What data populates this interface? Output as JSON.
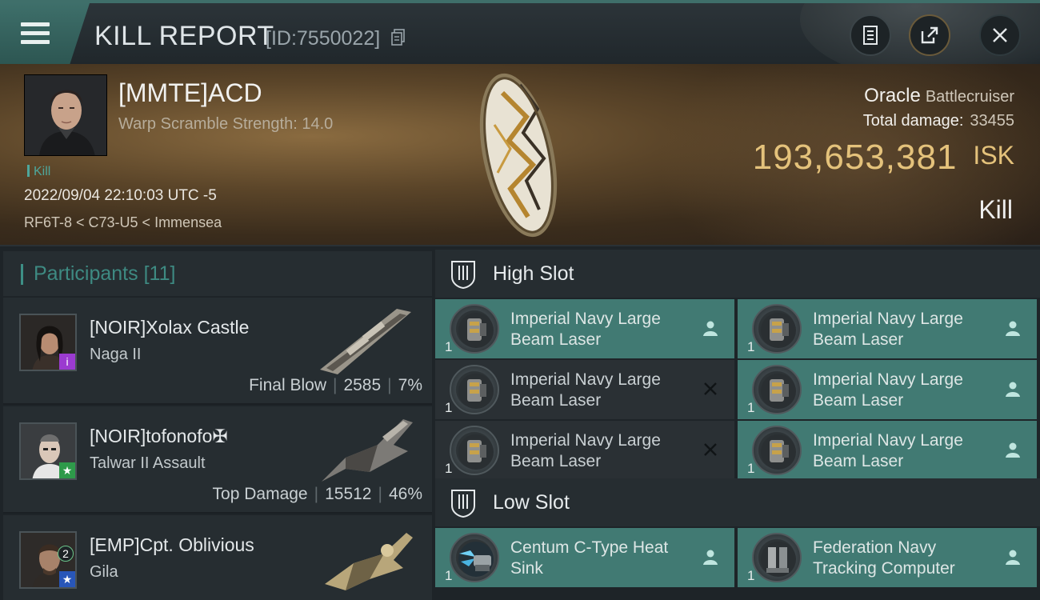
{
  "header": {
    "title": "KILL REPORT",
    "report_id": "[ID:7550022]"
  },
  "victim": {
    "name": "[MMTE]ACD",
    "scram": "Warp Scramble Strength: 14.0",
    "kill_tag": "Kill",
    "timestamp": "2022/09/04 22:10:03 UTC -5",
    "location": "RF6T-8 < C73-U5 < Immensea",
    "ship_name": "Oracle",
    "ship_class": "Battlecruiser",
    "damage_label": "Total damage:",
    "damage_value": "33455",
    "isk_value": "193,653,381",
    "isk_unit": "ISK",
    "result": "Kill"
  },
  "participants": {
    "label": "Participants",
    "count": "[11]",
    "rows": [
      {
        "name": "[NOIR]Xolax Castle",
        "ship": "Naga II",
        "stat_label": "Final Blow",
        "damage": "2585",
        "percent": "7%",
        "badge": "i"
      },
      {
        "name": "[NOIR]tofonofo✠",
        "ship": "Talwar II Assault",
        "stat_label": "Top Damage",
        "damage": "15512",
        "percent": "46%",
        "badge": "★"
      },
      {
        "name": "[EMP]Cpt. Oblivious",
        "ship": "Gila",
        "stat_label": "",
        "damage": "",
        "percent": "",
        "badge": "★",
        "badge_num": "2"
      }
    ]
  },
  "fittings": {
    "high_label": "High Slot",
    "low_label": "Low Slot",
    "high": [
      {
        "name": "Imperial Navy Large Beam Laser",
        "qty": "1",
        "state": "active"
      },
      {
        "name": "Imperial Navy Large Beam Laser",
        "qty": "1",
        "state": "active"
      },
      {
        "name": "Imperial Navy Large Beam Laser",
        "qty": "1",
        "state": "destroyed"
      },
      {
        "name": "Imperial Navy Large Beam Laser",
        "qty": "1",
        "state": "active"
      },
      {
        "name": "Imperial Navy Large Beam Laser",
        "qty": "1",
        "state": "destroyed"
      },
      {
        "name": "Imperial Navy Large Beam Laser",
        "qty": "1",
        "state": "active"
      }
    ],
    "low": [
      {
        "name": "Centum C-Type Heat Sink",
        "qty": "1",
        "state": "active"
      },
      {
        "name": "Federation Navy Tracking Computer",
        "qty": "1",
        "state": "active"
      }
    ]
  },
  "colors": {
    "accent_teal": "#417a73",
    "isk_gold": "#e4c27b",
    "kill_tag": "#4ea79c"
  }
}
